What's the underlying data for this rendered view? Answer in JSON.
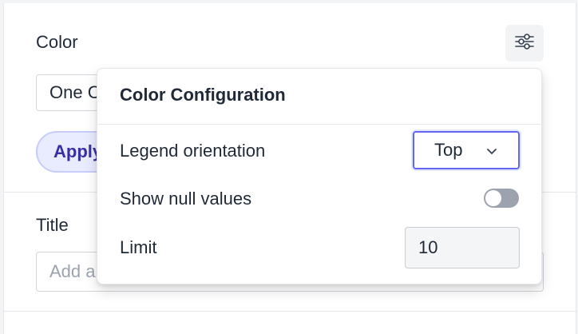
{
  "color_section": {
    "label": "Color",
    "settings_icon": "sliders-icon",
    "select_value": "One Color",
    "chip_label": "Apply"
  },
  "title_section": {
    "label": "Title",
    "input_value": "",
    "input_placeholder": "Add a title"
  },
  "popover": {
    "title": "Color Configuration",
    "legend_orientation": {
      "label": "Legend orientation",
      "value": "Top",
      "icon": "chevron-down-icon"
    },
    "show_null_values": {
      "label": "Show null values",
      "checked": false
    },
    "limit": {
      "label": "Limit",
      "value": "10"
    }
  },
  "colors": {
    "accent": "#6366f1",
    "chip_text": "#3730a3",
    "chip_bg": "#e9ebfe",
    "toggle_off": "#9ca3af"
  }
}
